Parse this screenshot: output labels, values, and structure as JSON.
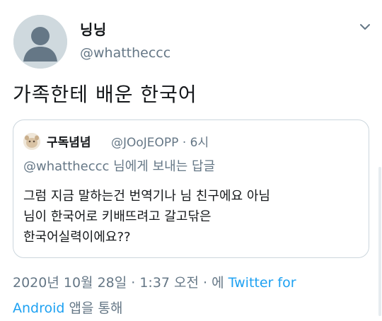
{
  "tweet": {
    "display_name": "닝닝",
    "handle": "@whattheccc",
    "text": "가족한테 배운 한국어",
    "avatar_icon": "default-profile-icon",
    "menu_icon": "chevron-down-icon"
  },
  "quote": {
    "display_name": "구독념념",
    "meta": "@JOoJEOPP · 6시",
    "reply_to": "@whattheccc 님에게 보내는 답글",
    "lines": [
      "그럼 지금 말하는건 번역기나 님 친구에요 아님",
      "님이 한국어로 키배뜨려고 갈고닦은",
      "한국어실력이에요??"
    ]
  },
  "footer": {
    "timestamp": "2020년 10월 28일 · 1:37 오전 · 에",
    "via": "Twitter for Android",
    "via_line1": "Twitter for",
    "via_line2": "Android",
    "suffix": "앱을 통해"
  },
  "colors": {
    "text": "#14171a",
    "secondary": "#657786",
    "accent": "#1da1f2",
    "border": "#ccd6dd"
  }
}
